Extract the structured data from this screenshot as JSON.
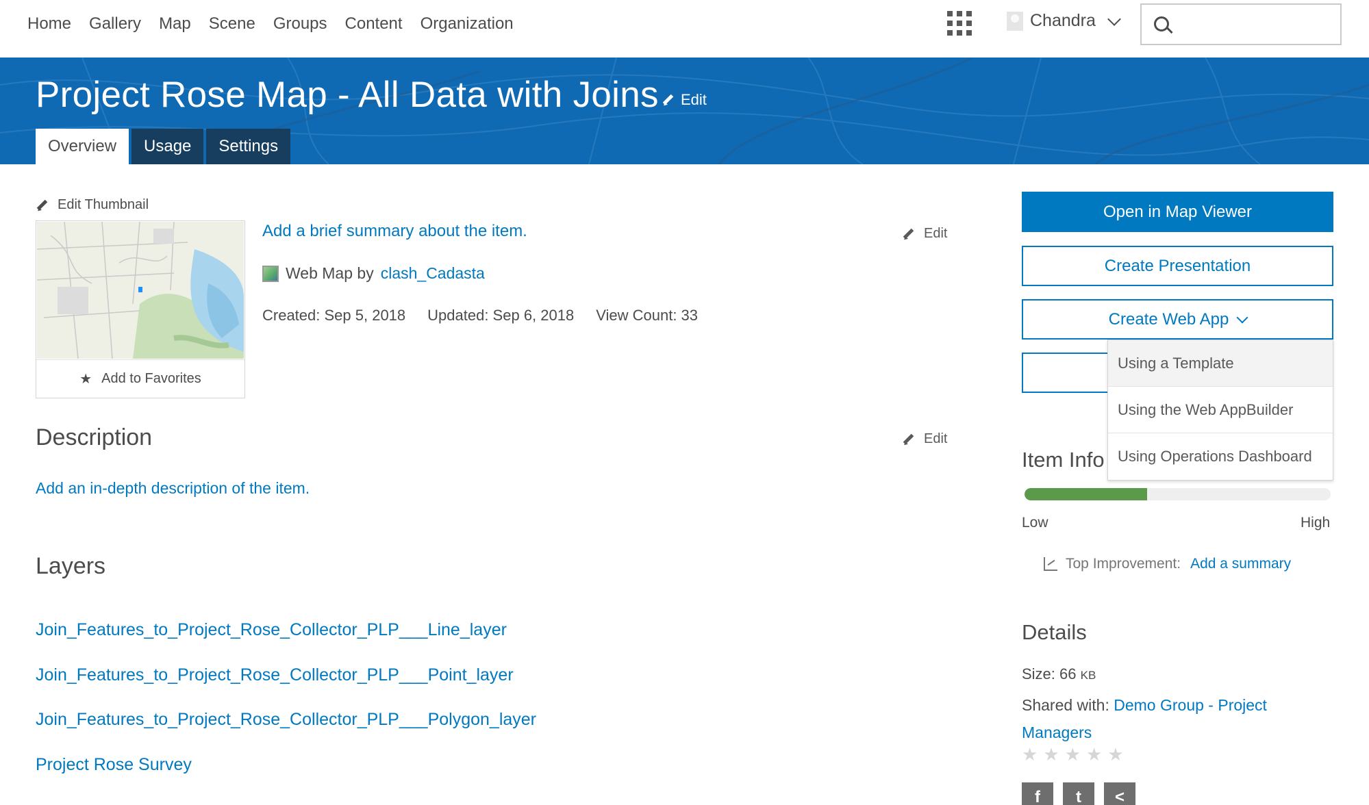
{
  "nav": {
    "links": [
      "Home",
      "Gallery",
      "Map",
      "Scene",
      "Groups",
      "Content",
      "Organization"
    ],
    "user_name": "Chandra",
    "search_value": ""
  },
  "header": {
    "title": "Project Rose Map - All Data with Joins",
    "edit_label": "Edit",
    "tabs": [
      {
        "label": "Overview",
        "active": true
      },
      {
        "label": "Usage",
        "active": false
      },
      {
        "label": "Settings",
        "active": false
      }
    ]
  },
  "overview": {
    "edit_thumbnail_label": "Edit Thumbnail",
    "add_favorites_label": "Add to Favorites",
    "summary_placeholder": "Add a brief summary about the item.",
    "summary_edit_label": "Edit",
    "item_type": "Web Map by",
    "owner": "clash_Cadasta",
    "created": "Created: Sep 5, 2018",
    "updated": "Updated: Sep 6, 2018",
    "view_count": "View Count: 33"
  },
  "description": {
    "heading": "Description",
    "edit_label": "Edit",
    "placeholder": "Add an in-depth description of the item."
  },
  "layers": {
    "heading": "Layers",
    "items": [
      "Join_Features_to_Project_Rose_Collector_PLP___Line_layer",
      "Join_Features_to_Project_Rose_Collector_PLP___Point_layer",
      "Join_Features_to_Project_Rose_Collector_PLP___Polygon_layer",
      "Project Rose Survey"
    ]
  },
  "actions": {
    "open_map_viewer": "Open in Map Viewer",
    "create_presentation": "Create Presentation",
    "create_web_app": "Create Web App",
    "web_app_menu": [
      "Using a Template",
      "Using the Web AppBuilder",
      "Using Operations Dashboard"
    ]
  },
  "item_info": {
    "heading": "Item Info",
    "low_label": "Low",
    "high_label": "High",
    "score_fraction": 0.4,
    "top_improvement_label": "Top Improvement:",
    "top_improvement_link": "Add a summary"
  },
  "details": {
    "heading": "Details",
    "size_label": "Size: 66",
    "size_unit": "KB",
    "shared_label": "Shared with:",
    "shared_group": "Demo Group - Project Managers",
    "rating_stars": 5
  },
  "colors": {
    "accent": "#0079c1",
    "banner": "#0f6ab3",
    "tab_dark": "#173d5f",
    "meter_fill": "#5a9a4a"
  },
  "icons": {
    "apps": "apps-grid-icon",
    "search": "search-icon",
    "edit": "pencil-icon",
    "favorite": "star-icon",
    "improvement": "chart-icon",
    "share": [
      "facebook-icon",
      "twitter-icon",
      "share-icon"
    ]
  }
}
